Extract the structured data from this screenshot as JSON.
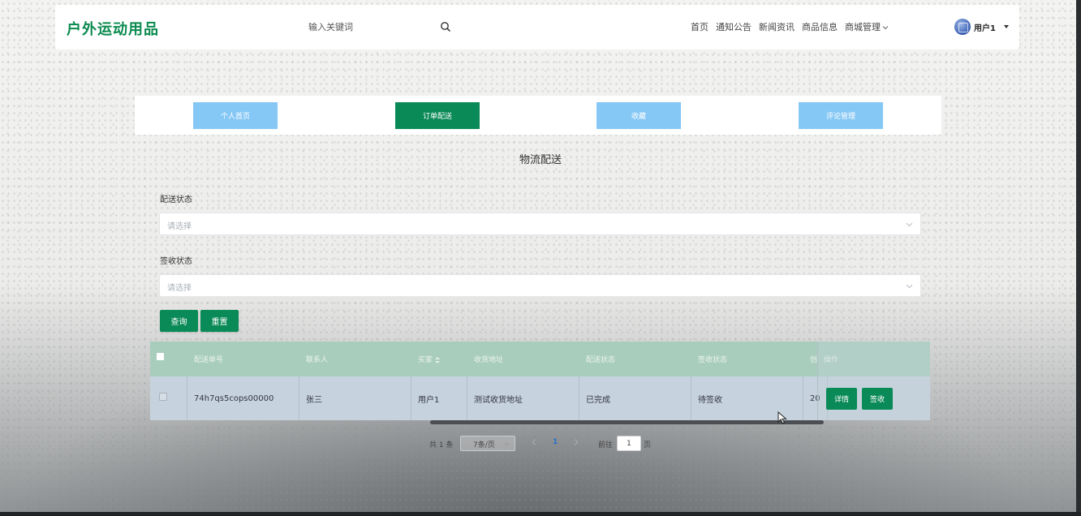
{
  "header": {
    "logo": "户外运动用品",
    "search_placeholder": "输入关键词",
    "nav": [
      "首页",
      "通知公告",
      "新闻资讯",
      "商品信息",
      "商城管理"
    ],
    "user_name": "用户1"
  },
  "tabs": [
    {
      "label": "个人首页",
      "active": false
    },
    {
      "label": "订单配送",
      "active": true
    },
    {
      "label": "收藏",
      "active": false
    },
    {
      "label": "评论管理",
      "active": false
    }
  ],
  "page_title": "物流配送",
  "filters": [
    {
      "label": "配送状态",
      "placeholder": "请选择"
    },
    {
      "label": "签收状态",
      "placeholder": "请选择"
    }
  ],
  "buttons": {
    "query": "查询",
    "reset": "重置"
  },
  "table": {
    "columns": [
      "配送单号",
      "联系人",
      "买家",
      "收货地址",
      "配送状态",
      "签收状态",
      "创",
      "操作"
    ],
    "rows": [
      {
        "cells": [
          "74h7qs5cops00000",
          "张三",
          "用户1",
          "测试收货地址",
          "已完成",
          "待签收",
          "20"
        ],
        "actions": [
          "详情",
          "签收"
        ]
      }
    ]
  },
  "pagination": {
    "total": "共 1 条",
    "page_size": "7条/页",
    "current_page": "1",
    "goto_label": "前往",
    "goto_value": "1",
    "goto_unit": "页"
  },
  "colors": {
    "brand_green": "#0a8a56",
    "tab_blue": "#86c8f5",
    "table_header": "#a8cdbd",
    "page_active": "#2570d0"
  }
}
